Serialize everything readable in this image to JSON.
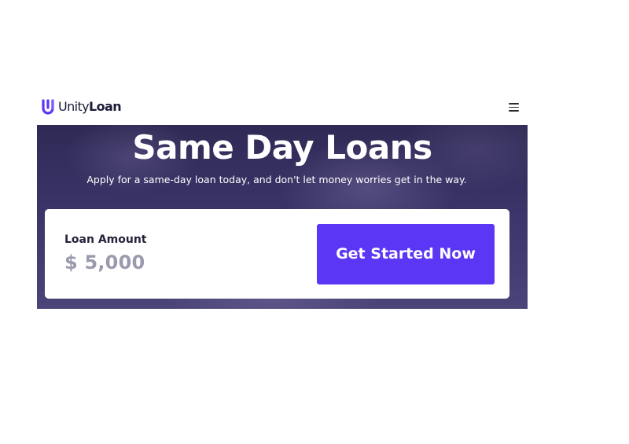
{
  "brand": {
    "name_light": "Unity",
    "name_bold": "Loan",
    "accent_color": "#5b36f5",
    "icon": "unityloan-logo-mark"
  },
  "nav": {
    "menu_icon": "hamburger-menu-icon"
  },
  "hero": {
    "title": "Same Day Loans",
    "subtitle": "Apply for a same-day loan today, and don't let money worries get in the way."
  },
  "loan_card": {
    "amount_label": "Loan Amount",
    "amount_value": "$ 5,000",
    "cta_label": "Get Started Now",
    "cta_color": "#5b36f5"
  }
}
